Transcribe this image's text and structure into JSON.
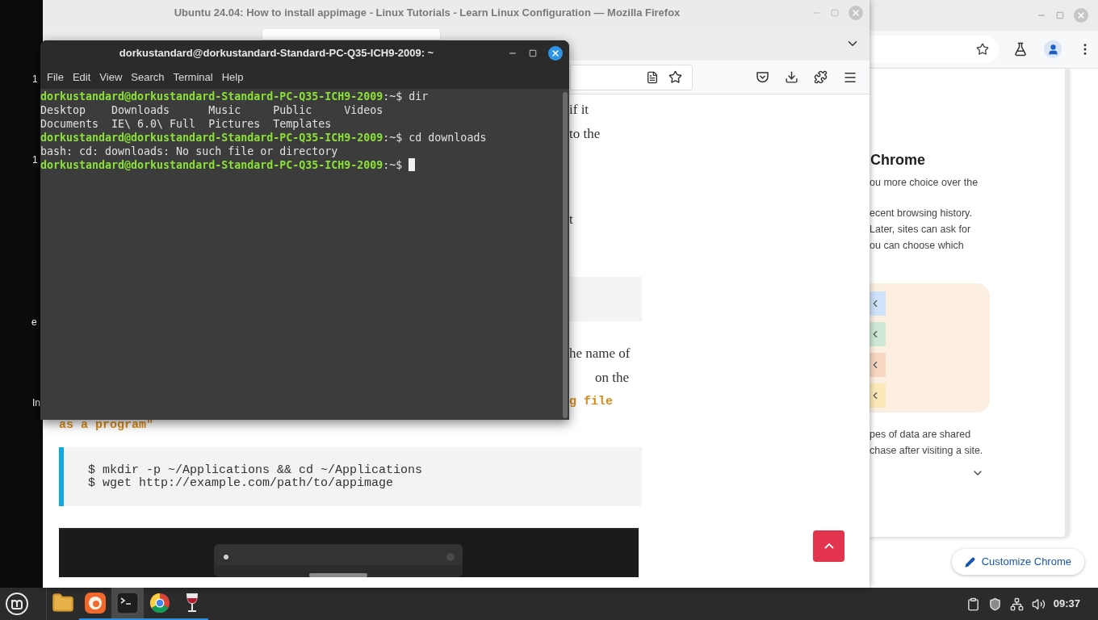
{
  "desktop": {
    "labels": [
      "1",
      "1",
      "e",
      "In"
    ]
  },
  "chrome": {
    "panel": {
      "heading": "Chrome",
      "lines_top": [
        "ou more choice over the"
      ],
      "lines_middle": [
        "ecent browsing history.",
        "Later, sites can ask for",
        "ou can choose which"
      ],
      "chips": [
        {
          "color": "#cfe2fb"
        },
        {
          "color": "#cde8d4"
        },
        {
          "color": "#f7d6c2"
        },
        {
          "color": "#fbe9b8"
        }
      ],
      "lines_bottom": [
        "pes of data are shared",
        "chase after visiting a site."
      ]
    },
    "customize_button": "Customize Chrome"
  },
  "firefox": {
    "title": "Ubuntu 24.04: How to install appimage - Linux Tutorials - Learn Linux Configuration — Mozilla Firefox",
    "page": {
      "fragments_top": [
        "if it",
        "to the"
      ],
      "fragment_mid": "t",
      "fragments_lower": [
        {
          "text": "he name of",
          "kind": "prose"
        },
        {
          "text": "on the",
          "kind": "prose"
        },
        {
          "text": "g file",
          "kind": "code"
        }
      ],
      "code_tail": "as a program\"",
      "code_lines": [
        "$ mkdir -p ~/Applications && cd ~/Applications",
        "$ wget http://example.com/path/to/appimage"
      ],
      "image": {
        "kind": "picture"
      }
    }
  },
  "terminal": {
    "title": "dorkustandard@dorkustandard-Standard-PC-Q35-ICH9-2009: ~",
    "menu": [
      "File",
      "Edit",
      "View",
      "Search",
      "Terminal",
      "Help"
    ],
    "lines": [
      {
        "kind": "prompt",
        "user": "dorkustandard@dorkustandard-Standard-PC-Q35-ICH9-2009",
        "path": ":~$ ",
        "command": "dir"
      },
      {
        "kind": "output",
        "text": "Desktop    Downloads      Music     Public     Videos"
      },
      {
        "kind": "output",
        "text": "Documents  IE\\ 6.0\\ Full  Pictures  Templates"
      },
      {
        "kind": "prompt",
        "user": "dorkustandard@dorkustandard-Standard-PC-Q35-ICH9-2009",
        "path": ":~$ ",
        "command": "cd downloads"
      },
      {
        "kind": "output",
        "text": "bash: cd: downloads: No such file or directory"
      },
      {
        "kind": "prompt",
        "user": "dorkustandard@dorkustandard-Standard-PC-Q35-ICH9-2009",
        "path": ":~$ ",
        "cursor": true
      }
    ]
  },
  "taskbar": {
    "apps": [
      {
        "kind": "files",
        "active": false,
        "running": false
      },
      {
        "kind": "firefox",
        "active": false,
        "running": true
      },
      {
        "kind": "terminal",
        "active": true,
        "running": true
      },
      {
        "kind": "chrome",
        "active": false,
        "running": true
      },
      {
        "kind": "wine",
        "active": false,
        "running": true
      }
    ],
    "clock": "09:37"
  }
}
